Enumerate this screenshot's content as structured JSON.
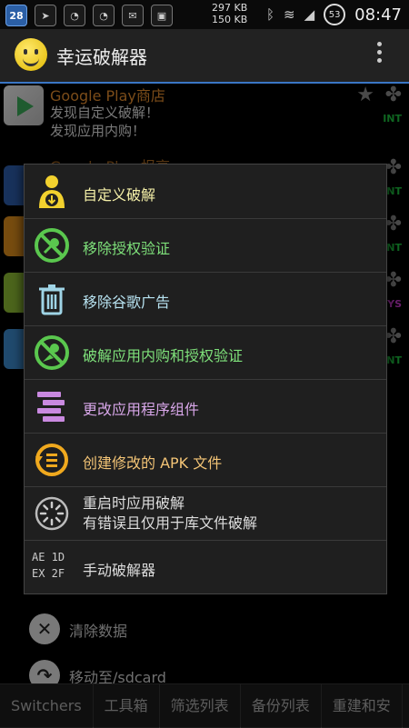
{
  "status_bar": {
    "date": "28",
    "speed_up": "297 KB",
    "speed_down": "150 KB",
    "battery": "53",
    "time": "08:47"
  },
  "app_bar": {
    "title": "幸运破解器"
  },
  "list_items": [
    {
      "title": "Google Play商店",
      "subtitle_1": "发现自定义破解！",
      "subtitle_2": "发现应用内购！",
      "tag": "INT"
    },
    {
      "title": "Google Play 报亭",
      "tag": "INT"
    },
    {
      "tag": "INT"
    },
    {
      "tag": "SYS"
    },
    {
      "tag": "INT"
    }
  ],
  "list_actions": [
    {
      "label": "清除数据"
    },
    {
      "label": "移动至/sdcard"
    }
  ],
  "bottom_tabs": [
    "Switchers",
    "工具箱",
    "筛选列表",
    "备份列表",
    "重建和安"
  ],
  "menu": {
    "items": [
      {
        "label": "自定义破解",
        "color": "#f5f0a8"
      },
      {
        "label": "移除授权验证",
        "color": "#7ee07a"
      },
      {
        "label": "移除谷歌广告",
        "color": "#b7e2f0"
      },
      {
        "label": "破解应用内购和授权验证",
        "color": "#7ee07a"
      },
      {
        "label": "更改应用程序组件",
        "color": "#d7a6e8"
      },
      {
        "label": "创建修改的 APK 文件",
        "color": "#f3c476"
      },
      {
        "label_1": "重启时应用破解",
        "label_2": "有错误且仅用于库文件破解"
      },
      {
        "label": "手动破解器",
        "icon_text_1": "AE 1D",
        "icon_text_2": "EX 2F"
      }
    ]
  }
}
